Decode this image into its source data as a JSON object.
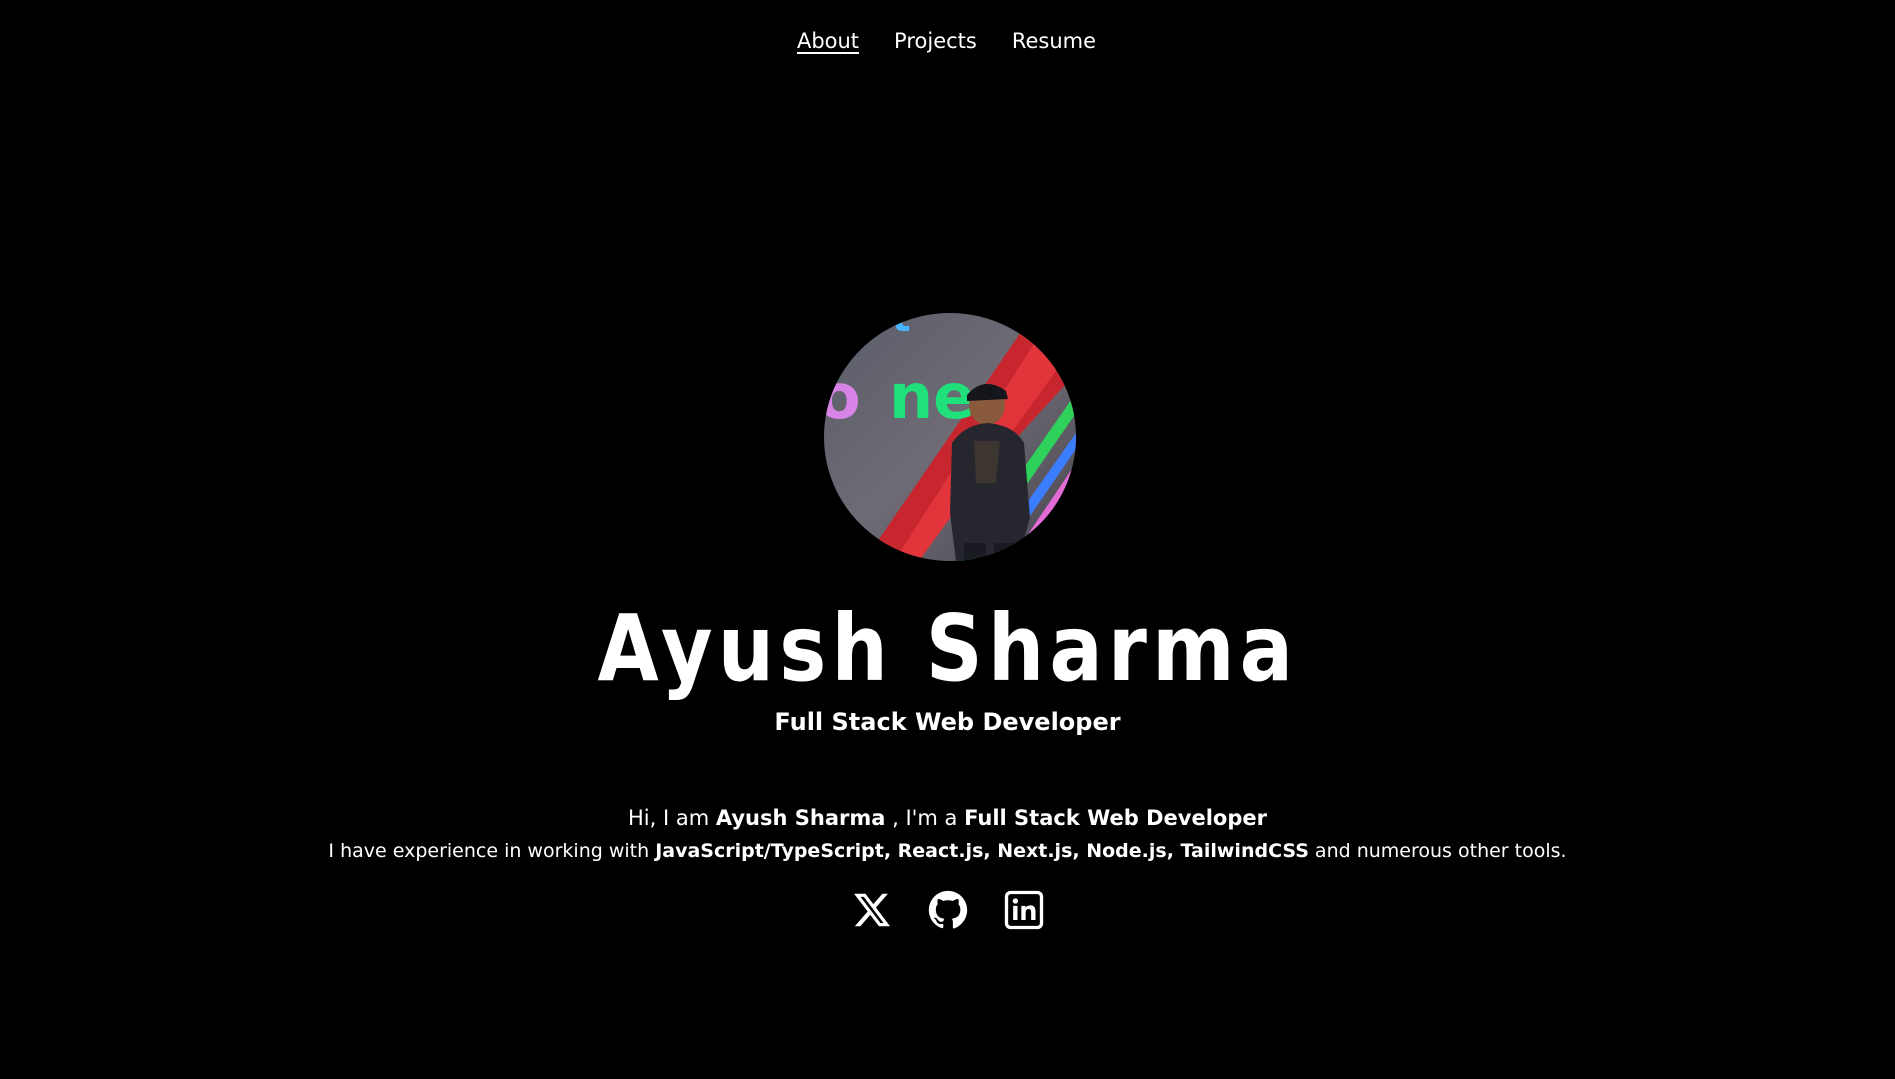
{
  "nav": {
    "items": [
      {
        "label": "About",
        "active": true
      },
      {
        "label": "Projects",
        "active": false
      },
      {
        "label": "Resume",
        "active": false
      }
    ]
  },
  "profile": {
    "name": "Ayush Sharma",
    "role": "Full Stack Web Developer"
  },
  "intro": {
    "prefix": "Hi, I am ",
    "name": "Ayush Sharma",
    "middle": " , I'm a ",
    "role": "Full Stack Web Developer"
  },
  "experience": {
    "prefix": "I have experience in working with ",
    "skills": "JavaScript/TypeScript, React.js, Next.js, Node.js, TailwindCSS",
    "suffix": " and numerous other tools."
  },
  "socials": [
    {
      "icon": "x-twitter-icon"
    },
    {
      "icon": "github-icon"
    },
    {
      "icon": "linkedin-icon"
    }
  ],
  "colors": {
    "background": "#000000",
    "text": "#ffffff"
  }
}
